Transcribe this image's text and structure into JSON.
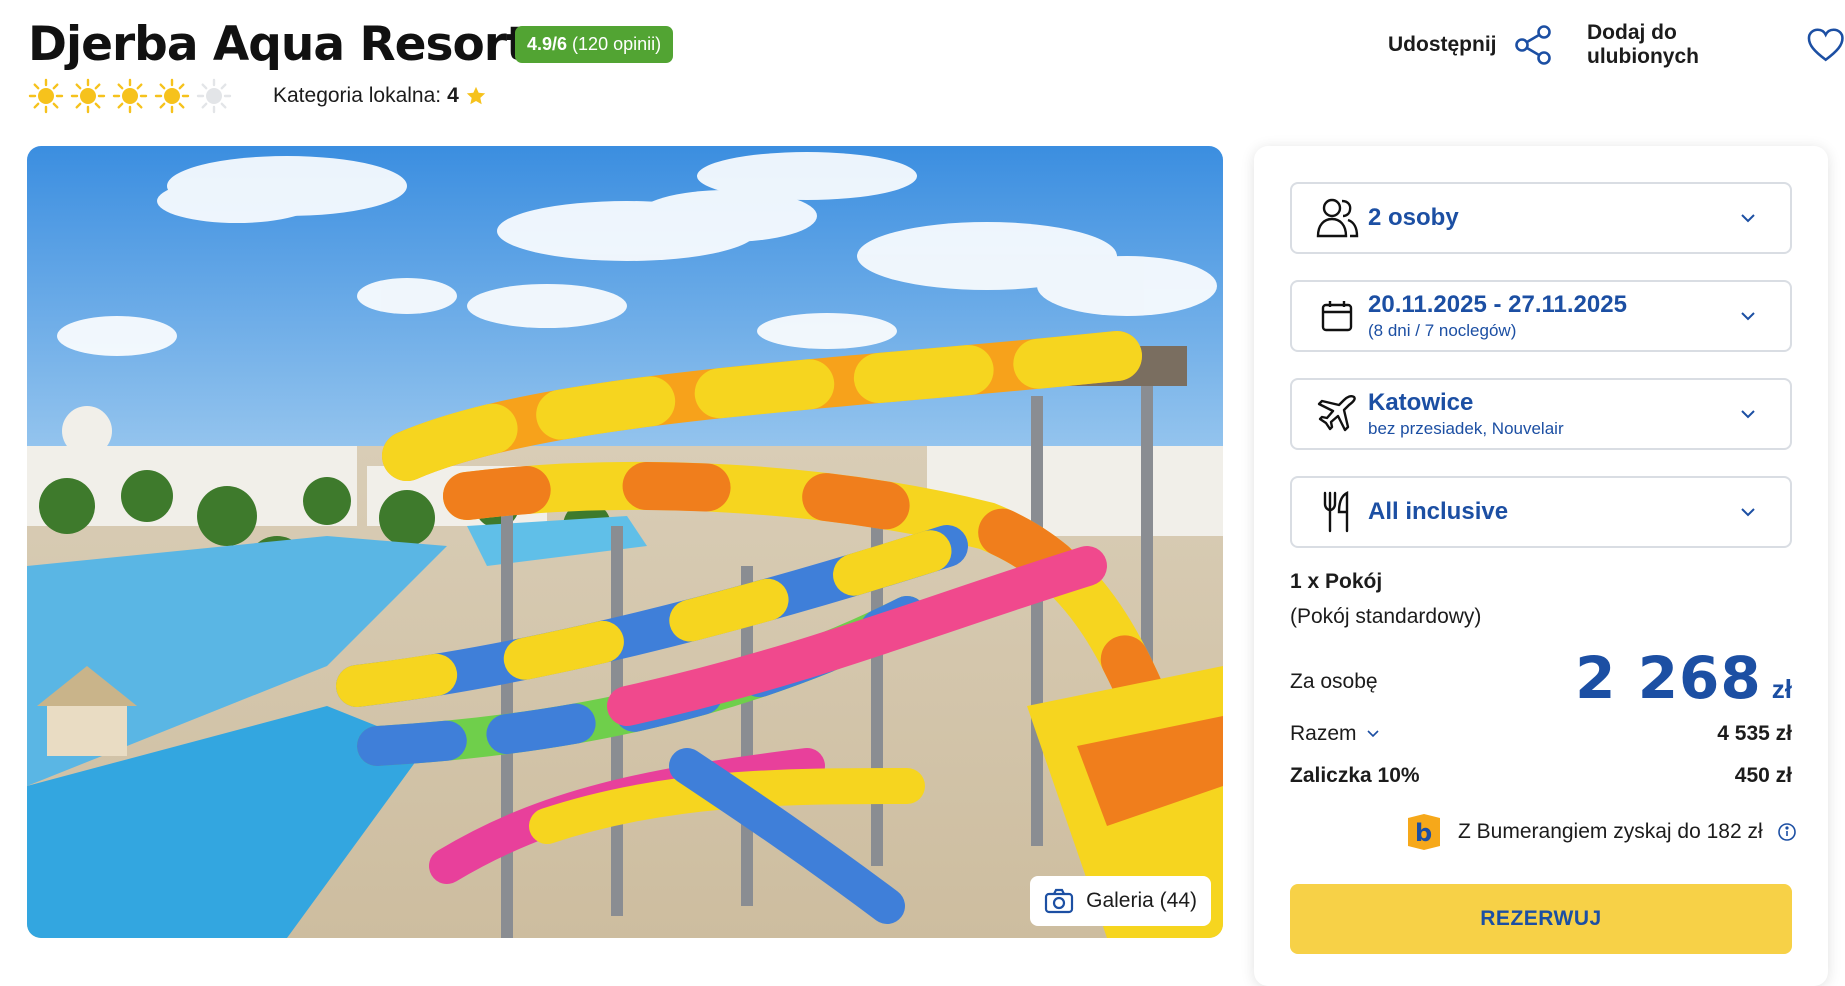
{
  "hotel": {
    "name": "Djerba Aqua Resort",
    "rating_score": "4.9/6",
    "rating_count": "(120 opinii)",
    "sun_rating": 4,
    "sun_max": 5,
    "local_category_label": "Kategoria lokalna:",
    "local_category_value": "4"
  },
  "actions": {
    "share_label": "Udostępnij",
    "favorite_label": "Dodaj do ulubionych"
  },
  "gallery": {
    "label": "Galeria (44)"
  },
  "booking": {
    "travelers": "2 osoby",
    "dates": "20.11.2025 - 27.11.2025",
    "dates_sub": "(8 dni / 7 noclegów)",
    "departure": "Katowice",
    "departure_sub": "bez przesiadek, Nouvelair",
    "board": "All inclusive",
    "room_line1": "1 x Pokój",
    "room_line2": "(Pokój standardowy)",
    "per_person_label": "Za osobę",
    "per_person_price": "2 268",
    "currency": "zł",
    "total_label": "Razem",
    "total_value": "4 535 zł",
    "deposit_label": "Zaliczka 10%",
    "deposit_value": "450 zł",
    "bumerang_text": "Z Bumerangiem zyskaj do 182 zł",
    "book_button": "REZERWUJ"
  },
  "colors": {
    "brand_blue": "#1c4fa3",
    "badge_green": "#52a433",
    "cta_yellow": "#f7d147",
    "sun_yellow": "#f6c21c"
  },
  "icons": [
    "sun-icon",
    "star-icon",
    "share-icon",
    "heart-icon",
    "camera-icon",
    "people-icon",
    "calendar-icon",
    "plane-icon",
    "cutlery-icon",
    "chevron-down-icon",
    "bumerang-icon",
    "info-icon"
  ]
}
